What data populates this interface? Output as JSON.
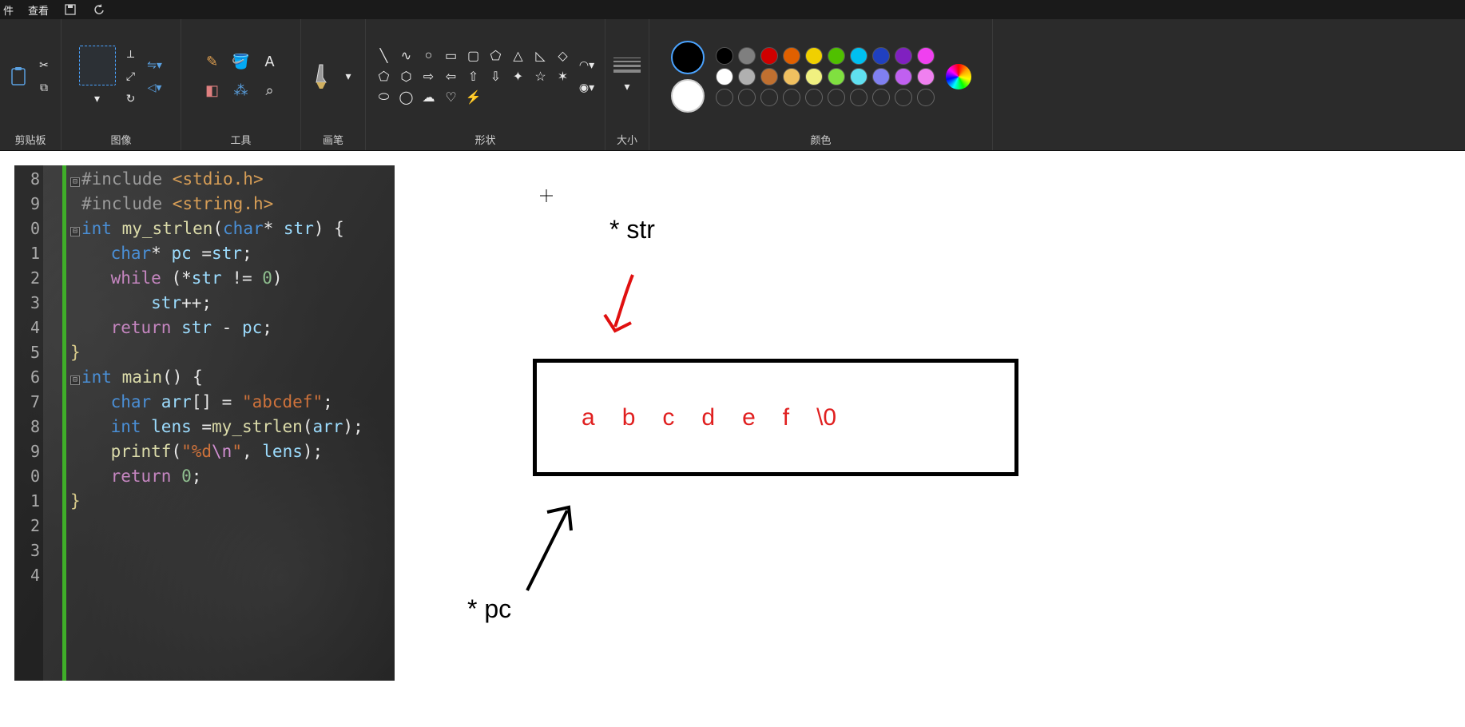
{
  "menu": {
    "file_tail": "件",
    "view": "查看"
  },
  "ribbon": {
    "clipboard_label": "剪贴板",
    "image_label": "图像",
    "tools_label": "工具",
    "brush_label": "画笔",
    "shapes_label": "形状",
    "size_label": "大小",
    "colors_label": "颜色"
  },
  "colors": {
    "primary": "#000000",
    "secondary": "#ffffff",
    "row1": [
      "#000000",
      "#7f7f7f",
      "#d00000",
      "#e06000",
      "#f0d000",
      "#50c000",
      "#00c0f0",
      "#2040c0",
      "#8020c0",
      "#f040f0"
    ],
    "row2": [
      "#ffffff",
      "#b0b0b0",
      "#c07030",
      "#f0c060",
      "#f0f080",
      "#80e040",
      "#60e0f0",
      "#8080f0",
      "#c060f0",
      "#f080f0"
    ]
  },
  "code": {
    "line_numbers": [
      "8",
      "9",
      "0",
      "1",
      "2",
      "3",
      "4",
      "5",
      "6",
      "7",
      "8",
      "9",
      "0",
      "1",
      "2",
      "3",
      "4"
    ],
    "lines": [
      [
        {
          "cls": "fold",
          "t": "⊟"
        },
        {
          "cls": "tok-pre",
          "t": "#include "
        },
        {
          "cls": "tok-inc",
          "t": "<stdio.h>"
        }
      ],
      [
        {
          "cls": "spacer",
          "t": " "
        },
        {
          "cls": "tok-pre",
          "t": "#include "
        },
        {
          "cls": "tok-inc",
          "t": "<string.h>"
        }
      ],
      [
        {
          "cls": "",
          "t": ""
        }
      ],
      [
        {
          "cls": "fold",
          "t": "⊟"
        },
        {
          "cls": "tok-kw",
          "t": "int "
        },
        {
          "cls": "tok-fn",
          "t": "my_strlen"
        },
        {
          "cls": "tok-white",
          "t": "("
        },
        {
          "cls": "tok-kw",
          "t": "char"
        },
        {
          "cls": "tok-white",
          "t": "* "
        },
        {
          "cls": "tok-var",
          "t": "str"
        },
        {
          "cls": "tok-white",
          "t": ") {"
        }
      ],
      [
        {
          "cls": "",
          "t": "    "
        },
        {
          "cls": "tok-kw",
          "t": "char"
        },
        {
          "cls": "tok-white",
          "t": "* "
        },
        {
          "cls": "tok-var",
          "t": "pc "
        },
        {
          "cls": "tok-white",
          "t": "="
        },
        {
          "cls": "tok-var",
          "t": "str"
        },
        {
          "cls": "tok-white",
          "t": ";"
        }
      ],
      [
        {
          "cls": "",
          "t": "    "
        },
        {
          "cls": "tok-ret",
          "t": "while "
        },
        {
          "cls": "tok-white",
          "t": "(*"
        },
        {
          "cls": "tok-var",
          "t": "str "
        },
        {
          "cls": "tok-white",
          "t": "!= "
        },
        {
          "cls": "tok-num",
          "t": "0"
        },
        {
          "cls": "tok-white",
          "t": ")"
        }
      ],
      [
        {
          "cls": "",
          "t": "        "
        },
        {
          "cls": "tok-var",
          "t": "str"
        },
        {
          "cls": "tok-white",
          "t": "++;"
        }
      ],
      [
        {
          "cls": "",
          "t": "    "
        },
        {
          "cls": "tok-ret",
          "t": "return "
        },
        {
          "cls": "tok-var",
          "t": "str "
        },
        {
          "cls": "tok-white",
          "t": "- "
        },
        {
          "cls": "tok-var",
          "t": "pc"
        },
        {
          "cls": "tok-white",
          "t": ";"
        }
      ],
      [
        {
          "cls": "",
          "t": ""
        },
        {
          "cls": "tok-par",
          "t": "}"
        }
      ],
      [
        {
          "cls": "",
          "t": ""
        }
      ],
      [
        {
          "cls": "fold",
          "t": "⊟"
        },
        {
          "cls": "tok-kw",
          "t": "int "
        },
        {
          "cls": "tok-fn",
          "t": "main"
        },
        {
          "cls": "tok-white",
          "t": "() {"
        }
      ],
      [
        {
          "cls": "",
          "t": "    "
        },
        {
          "cls": "tok-kw",
          "t": "char "
        },
        {
          "cls": "tok-var",
          "t": "arr"
        },
        {
          "cls": "tok-white",
          "t": "[] = "
        },
        {
          "cls": "tok-str",
          "t": "\"abcdef\""
        },
        {
          "cls": "tok-white",
          "t": ";"
        }
      ],
      [
        {
          "cls": "",
          "t": "    "
        },
        {
          "cls": "tok-kw",
          "t": "int "
        },
        {
          "cls": "tok-var",
          "t": "lens "
        },
        {
          "cls": "tok-white",
          "t": "="
        },
        {
          "cls": "tok-fn",
          "t": "my_strlen"
        },
        {
          "cls": "tok-white",
          "t": "("
        },
        {
          "cls": "tok-var",
          "t": "arr"
        },
        {
          "cls": "tok-white",
          "t": ");"
        }
      ],
      [
        {
          "cls": "",
          "t": "    "
        },
        {
          "cls": "tok-fn",
          "t": "printf"
        },
        {
          "cls": "tok-white",
          "t": "("
        },
        {
          "cls": "tok-str",
          "t": "\"%d"
        },
        {
          "cls": "tok-esc",
          "t": "\\n"
        },
        {
          "cls": "tok-str",
          "t": "\""
        },
        {
          "cls": "tok-white",
          "t": ", "
        },
        {
          "cls": "tok-var",
          "t": "lens"
        },
        {
          "cls": "tok-white",
          "t": ");"
        }
      ],
      [
        {
          "cls": "",
          "t": "    "
        },
        {
          "cls": "tok-ret",
          "t": "return "
        },
        {
          "cls": "tok-num",
          "t": "0"
        },
        {
          "cls": "tok-white",
          "t": ";"
        }
      ],
      [
        {
          "cls": "",
          "t": ""
        },
        {
          "cls": "tok-par",
          "t": "}"
        }
      ],
      [
        {
          "cls": "",
          "t": ""
        }
      ]
    ]
  },
  "diagram": {
    "str_label": "* str",
    "pc_label": "* pc",
    "array": [
      "a",
      "b",
      "c",
      "d",
      "e",
      "f",
      "\\0"
    ]
  }
}
